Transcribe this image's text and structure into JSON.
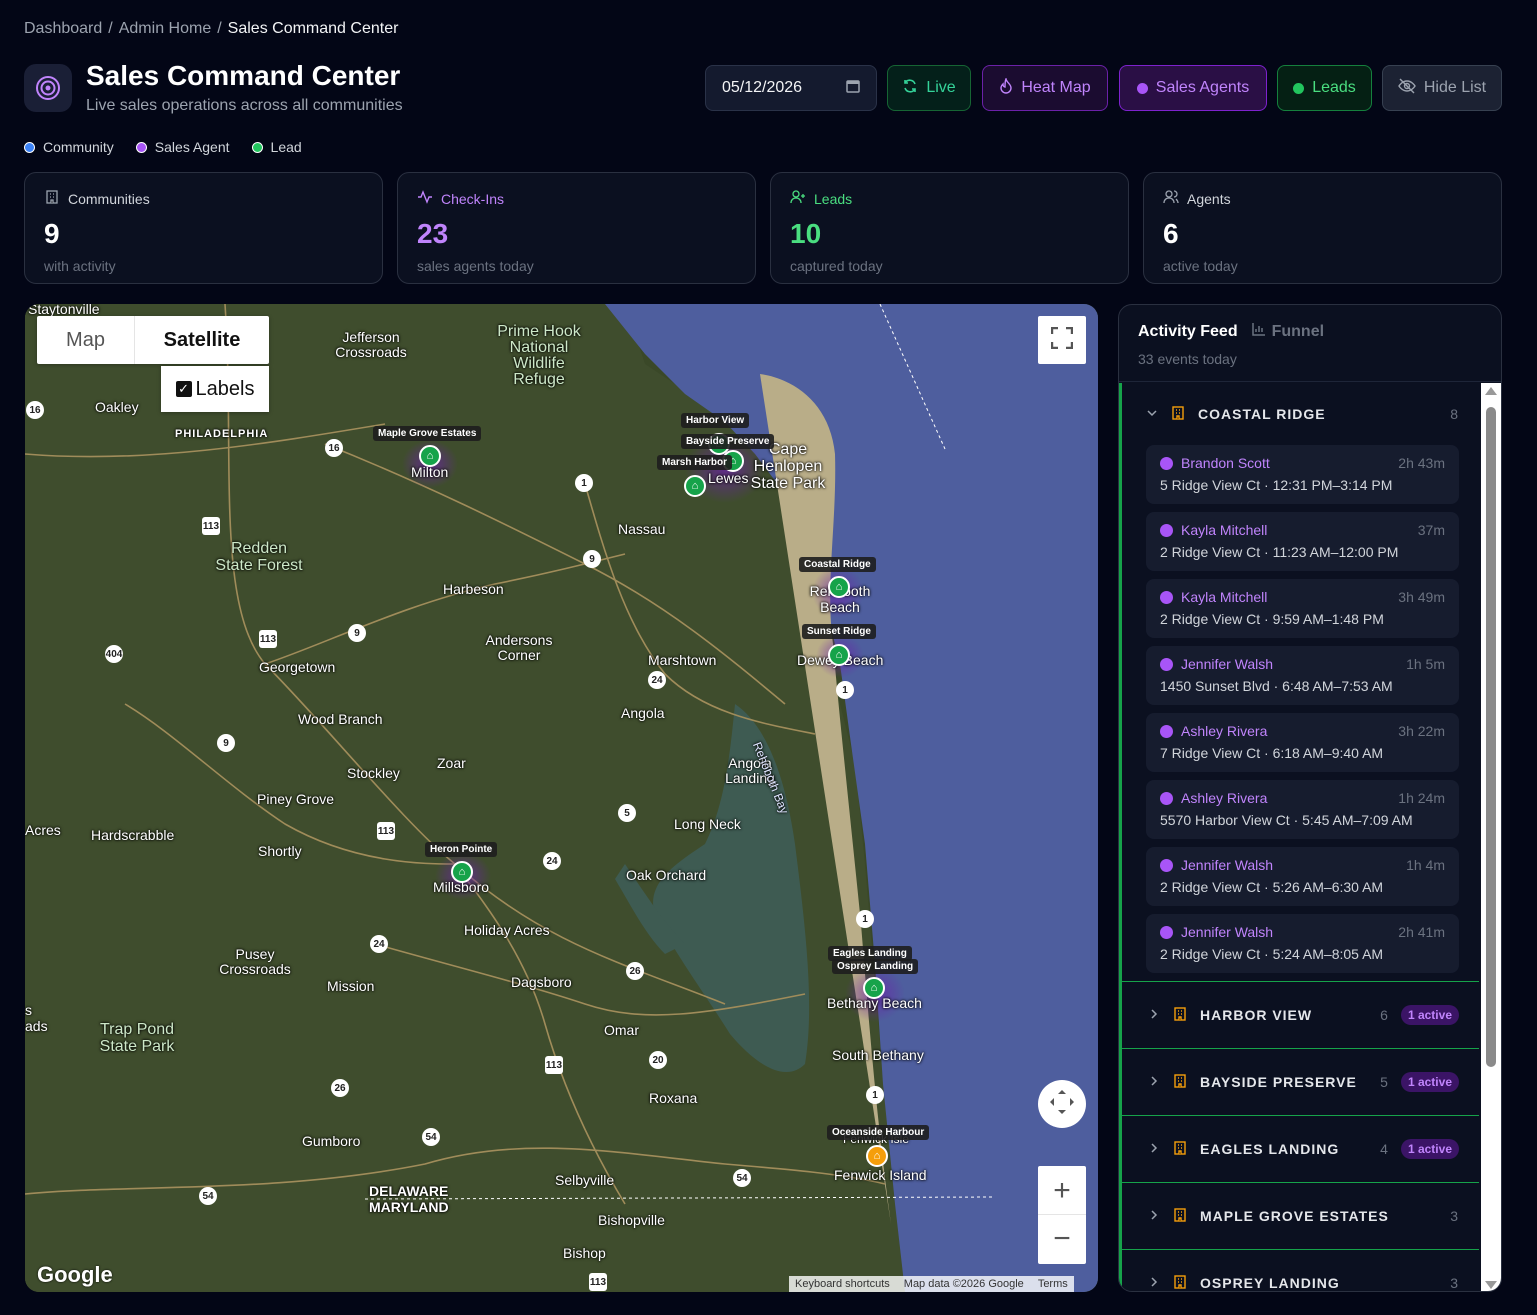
{
  "breadcrumb": [
    "Dashboard",
    "Admin Home",
    "Sales Command Center"
  ],
  "header": {
    "title": "Sales Command Center",
    "subtitle": "Live sales operations across all communities"
  },
  "toolbar": {
    "date": "05/12/2026",
    "live": "Live",
    "heat_map": "Heat Map",
    "sales_agents": "Sales Agents",
    "leads": "Leads",
    "hide_list": "Hide List"
  },
  "legend": [
    {
      "label": "Community",
      "color": "#3b82f6"
    },
    {
      "label": "Sales Agent",
      "color": "#a855f7"
    },
    {
      "label": "Lead",
      "color": "#22c55e"
    }
  ],
  "stats": [
    {
      "label": "Communities",
      "value": "9",
      "sub": "with activity",
      "color": "#d1d5db"
    },
    {
      "label": "Check-Ins",
      "value": "23",
      "sub": "sales agents today",
      "color": "#c084fc"
    },
    {
      "label": "Leads",
      "value": "10",
      "sub": "captured today",
      "color": "#4ade80"
    },
    {
      "label": "Agents",
      "value": "6",
      "sub": "active today",
      "color": "#d1d5db"
    }
  ],
  "map": {
    "type_map": "Map",
    "type_satellite": "Satellite",
    "labels": "Labels",
    "attribution": [
      "Keyboard shortcuts",
      "Map data ©2026 Google",
      "Terms"
    ],
    "google": "Google",
    "pins": [
      {
        "name": "Maple Grove Estates"
      },
      {
        "name": "Harbor View"
      },
      {
        "name": "Bayside Preserve"
      },
      {
        "name": "Marsh Harbor"
      },
      {
        "name": "Coastal Ridge"
      },
      {
        "name": "Sunset Ridge"
      },
      {
        "name": "Heron Pointe"
      },
      {
        "name": "Eagles Landing"
      },
      {
        "name": "Osprey Landing"
      },
      {
        "name": "Oceanside Harbour"
      }
    ],
    "towns": [
      "Staytonville",
      "Jefferson Crossroads",
      "Prime Hook National Wildlife Refuge",
      "Oakley",
      "PHILADELPHIA",
      "Milton",
      "Lewes",
      "Cape Henlopen State Park",
      "Nassau",
      "Redden State Forest",
      "Harbeson",
      "Rehoboth Beach",
      "Georgetown",
      "Andersons Corner",
      "Marshtown",
      "Dewey Beach",
      "Wood Branch",
      "Angola",
      "Stockley",
      "Zoar",
      "Angola Landing",
      "Rehoboth Bay",
      "Piney Grove",
      "Hardscrabble",
      "Acres",
      "Shortly",
      "Long Neck",
      "Millsboro",
      "Oak Orchard",
      "Holiday Acres",
      "Pusey Crossroads",
      "Mission",
      "Dagsboro",
      "Bethany Beach",
      "Trap Pond State Park",
      "Omar",
      "South Bethany",
      "Roxana",
      "Gumboro",
      "Fenwick Isle",
      "Fenwick Island",
      "Selbyville",
      "DELAWARE",
      "MARYLAND",
      "Bishopville",
      "Bishop",
      "ads",
      "s"
    ],
    "highways": [
      "16",
      "16",
      "1",
      "113",
      "9",
      "113",
      "9",
      "404",
      "24",
      "1",
      "9",
      "5",
      "113",
      "24",
      "1",
      "24",
      "26",
      "113",
      "20",
      "26",
      "1",
      "54",
      "54",
      "54",
      "113"
    ]
  },
  "feed": {
    "title": "Activity Feed",
    "funnel": "Funnel",
    "sub": "33 events today",
    "open_group": {
      "name": "COASTAL RIDGE",
      "count": "8"
    },
    "events": [
      {
        "agent": "Brandon Scott",
        "ago": "2h 43m",
        "detail": "5 Ridge View Ct · 12:31 PM–3:14 PM"
      },
      {
        "agent": "Kayla Mitchell",
        "ago": "37m",
        "detail": "2 Ridge View Ct · 11:23 AM–12:00 PM"
      },
      {
        "agent": "Kayla Mitchell",
        "ago": "3h 49m",
        "detail": "2 Ridge View Ct · 9:59 AM–1:48 PM"
      },
      {
        "agent": "Jennifer Walsh",
        "ago": "1h 5m",
        "detail": "1450 Sunset Blvd · 6:48 AM–7:53 AM"
      },
      {
        "agent": "Ashley Rivera",
        "ago": "3h 22m",
        "detail": "7 Ridge View Ct · 6:18 AM–9:40 AM"
      },
      {
        "agent": "Ashley Rivera",
        "ago": "1h 24m",
        "detail": "5570 Harbor View Ct · 5:45 AM–7:09 AM"
      },
      {
        "agent": "Jennifer Walsh",
        "ago": "1h 4m",
        "detail": "2 Ridge View Ct · 5:26 AM–6:30 AM"
      },
      {
        "agent": "Jennifer Walsh",
        "ago": "2h 41m",
        "detail": "2 Ridge View Ct · 5:24 AM–8:05 AM"
      }
    ],
    "groups": [
      {
        "name": "HARBOR VIEW",
        "count": "6",
        "badge": "1 active"
      },
      {
        "name": "BAYSIDE PRESERVE",
        "count": "5",
        "badge": "1 active"
      },
      {
        "name": "EAGLES LANDING",
        "count": "4",
        "badge": "1 active"
      },
      {
        "name": "MAPLE GROVE ESTATES",
        "count": "3",
        "badge": ""
      },
      {
        "name": "OSPREY LANDING",
        "count": "3",
        "badge": ""
      }
    ]
  }
}
